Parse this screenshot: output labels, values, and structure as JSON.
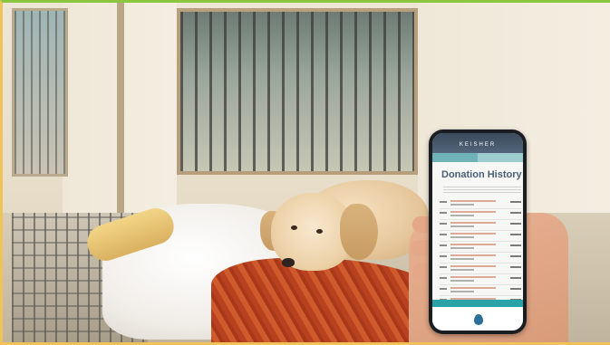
{
  "phone": {
    "app_name": "KEISHER",
    "tabs": [
      "",
      ""
    ],
    "screen_title": "Donation History"
  },
  "colors": {
    "frame_top": "#8cc63f",
    "frame_side": "#f0c35a",
    "app_header": "#3b4a5c",
    "app_accent": "#2aa3a7",
    "title_color": "#4a6076"
  }
}
